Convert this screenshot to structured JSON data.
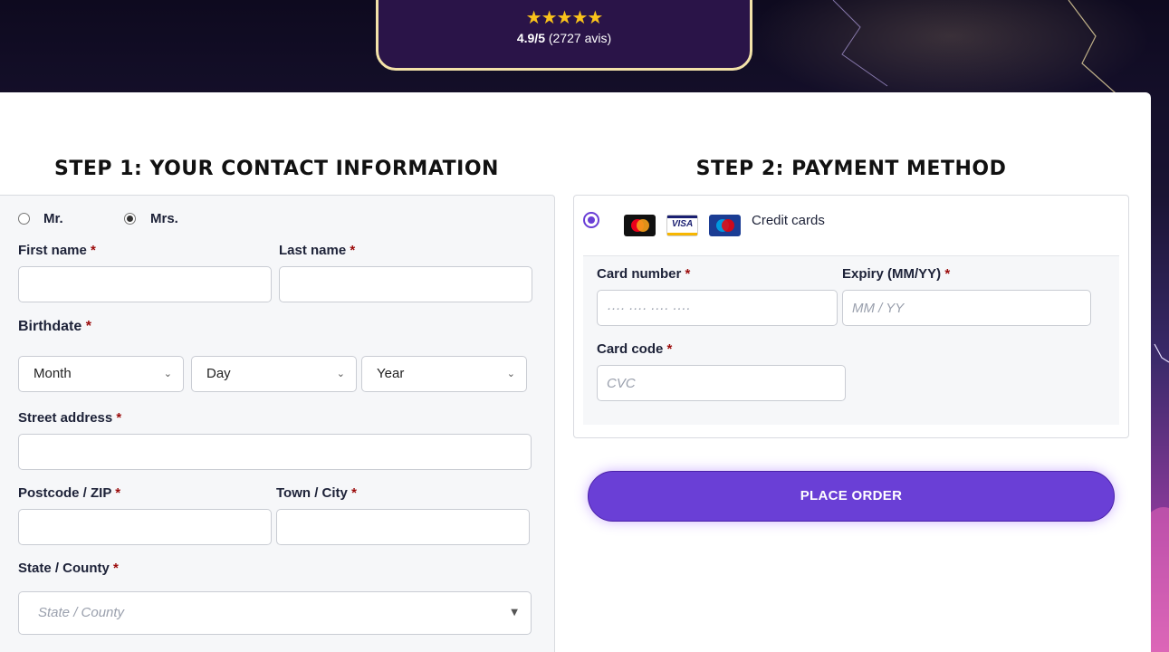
{
  "rating": {
    "stars": "★★★★★",
    "score": "4.9/5",
    "count": "(2727 avis)"
  },
  "step1": {
    "title": "STEP 1: YOUR CONTACT INFORMATION",
    "salutation": {
      "mr": "Mr.",
      "mrs": "Mrs."
    },
    "first_name_label": "First name",
    "last_name_label": "Last name",
    "birthdate_label": "Birthdate",
    "month": "Month",
    "day": "Day",
    "year": "Year",
    "street_label": "Street address",
    "postcode_label": "Postcode / ZIP",
    "town_label": "Town / City",
    "state_label": "State / County",
    "state_placeholder": "State / County",
    "required": "*"
  },
  "step2": {
    "title": "STEP 2: PAYMENT METHOD",
    "method_label": "Credit cards",
    "visa_text": "VISA",
    "card_number_label": "Card number",
    "card_number_placeholder": "···· ···· ···· ····",
    "expiry_label": "Expiry (MM/YY)",
    "expiry_placeholder": "MM / YY",
    "card_code_label": "Card code",
    "card_code_placeholder": "CVC",
    "required": "*"
  },
  "place_order": "PLACE ORDER",
  "colors": {
    "accent": "#6a3fd6",
    "required": "#9b0a0a",
    "star": "#f9c21b"
  }
}
